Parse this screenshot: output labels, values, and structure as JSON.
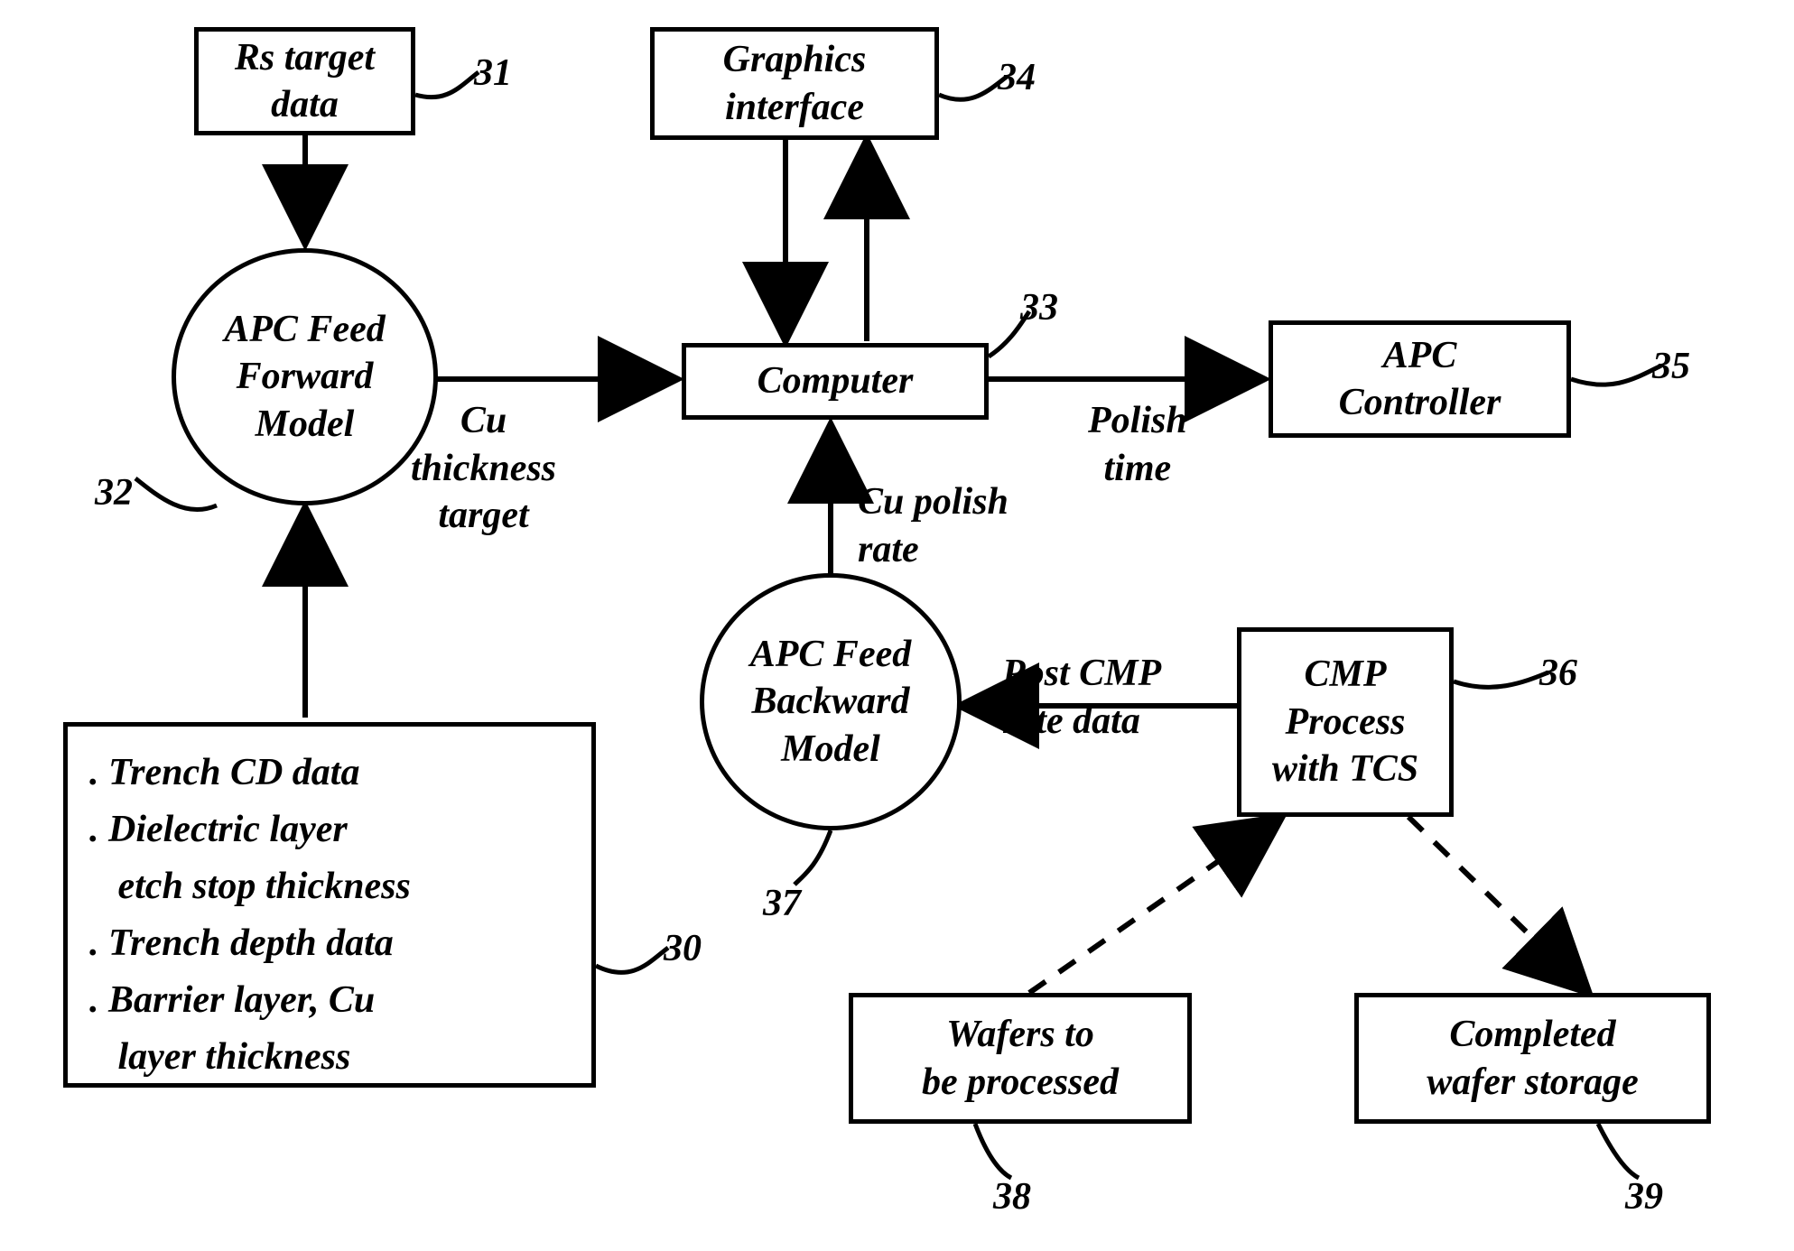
{
  "nodes": {
    "rs_target": {
      "text": "Rs target\ndata",
      "ref": "31"
    },
    "apc_ff": {
      "text": "APC Feed\nForward\nModel",
      "ref": "32"
    },
    "inputs_list": {
      "items": [
        ". Trench CD data",
        ". Dielectric layer\n   etch stop thickness",
        ". Trench depth data",
        ". Barrier layer, Cu\n   layer thickness"
      ],
      "ref": "30"
    },
    "graphics": {
      "text": "Graphics\ninterface",
      "ref": "34"
    },
    "computer": {
      "text": "Computer",
      "ref": "33"
    },
    "apc_ctrl": {
      "text": "APC\nController",
      "ref": "35"
    },
    "apc_fb": {
      "text": "APC Feed\nBackward\nModel",
      "ref": "37"
    },
    "cmp": {
      "text": "CMP\nProcess\nwith TCS",
      "ref": "36"
    },
    "wafers_in": {
      "text": "Wafers to\nbe processed",
      "ref": "38"
    },
    "wafers_out": {
      "text": "Completed\nwafer storage",
      "ref": "39"
    }
  },
  "edge_labels": {
    "cu_thickness_target": "Cu\nthickness\ntarget",
    "polish_time": "Polish\ntime",
    "cu_polish_rate": "Cu polish\nrate",
    "post_cmp_rate_data": "Post CMP\nrate data"
  }
}
